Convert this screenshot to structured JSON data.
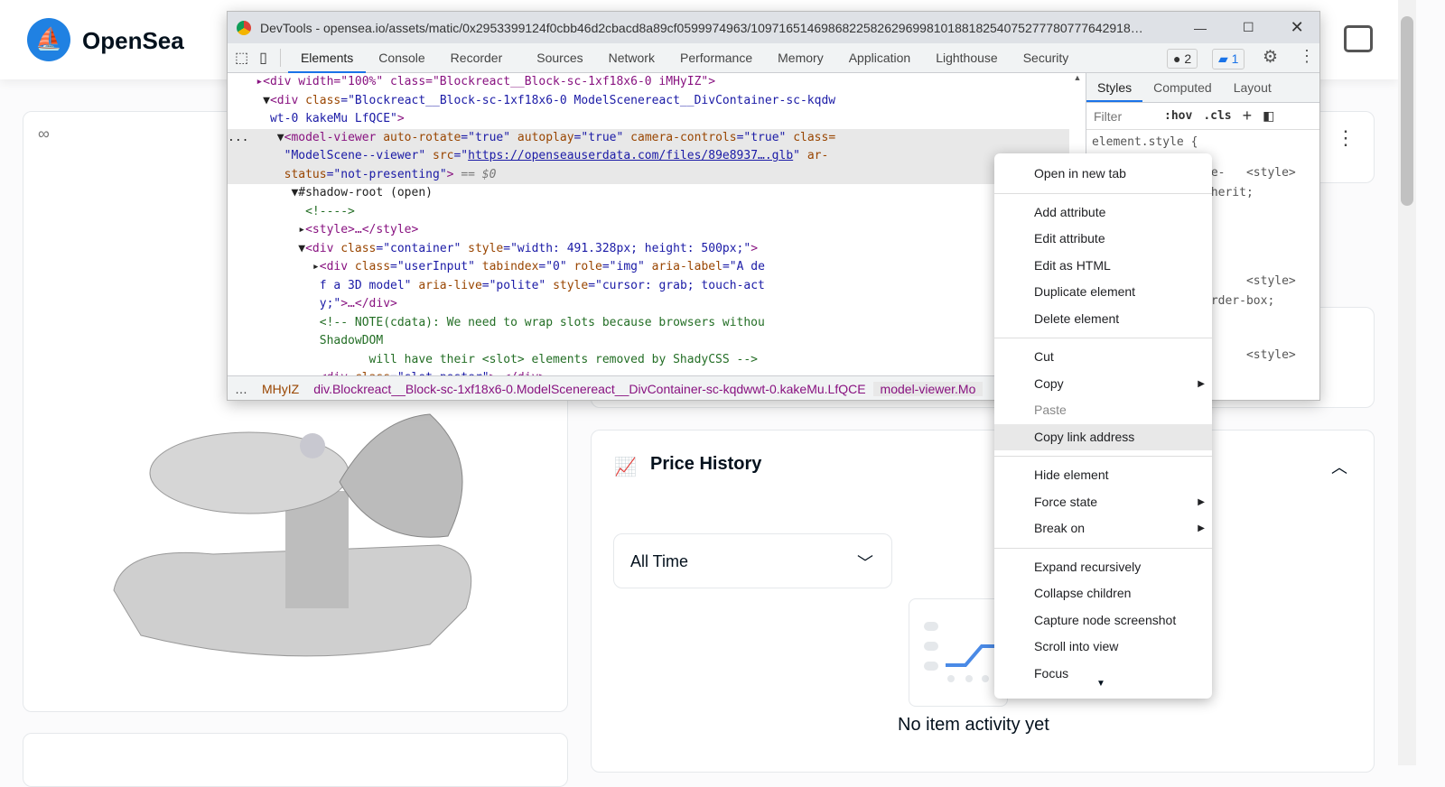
{
  "page": {
    "brand": "OpenSea",
    "price_history": "Price History",
    "filter_value": "All Time",
    "no_activity": "No item activity yet"
  },
  "devtools": {
    "title": "DevTools - opensea.io/assets/matic/0x2953399124f0cbb46d2cbacd8a89cf0599974963/109716514698682258262969981018818254075277780777642918…",
    "tabs": [
      "Elements",
      "Console",
      "Recorder",
      "Sources",
      "Network",
      "Performance",
      "Memory",
      "Application",
      "Lighthouse",
      "Security"
    ],
    "errors": "2",
    "messages": "1",
    "code": [
      [
        [
          "    ",
          "tx"
        ],
        [
          "▸<div width=\"100%\" class=\"Blockreact__Block-sc-1xf18x6-0 iMHyIZ\">",
          "tg"
        ]
      ],
      [
        [
          "     ▼",
          "tx"
        ],
        [
          "<div ",
          "tg"
        ],
        [
          "class",
          "at"
        ],
        [
          "=\"Blockreact__Block-sc-1xf18x6-0 ModelScenereact__DivContainer-sc-kqdw",
          "av"
        ]
      ],
      [
        [
          "      ",
          "tx"
        ],
        [
          "wt-0 kakeMu LfQCE\"",
          "av"
        ],
        [
          ">",
          "tg"
        ]
      ],
      [
        [
          "...    ▼",
          "tx"
        ],
        [
          "<model-viewer ",
          "tg"
        ],
        [
          "auto-rotate",
          "at"
        ],
        [
          "=\"true\" ",
          "av"
        ],
        [
          "autoplay",
          "at"
        ],
        [
          "=\"true\" ",
          "av"
        ],
        [
          "camera-controls",
          "at"
        ],
        [
          "=\"true\" ",
          "av"
        ],
        [
          "class=",
          "at"
        ]
      ],
      [
        [
          "        ",
          "tx"
        ],
        [
          "\"ModelScene--viewer\" ",
          "av"
        ],
        [
          "src",
          "at"
        ],
        [
          "=\"",
          "av"
        ],
        [
          "https://openseauserdata.com/files/89e8937….glb",
          "lk"
        ],
        [
          "\" ",
          "av"
        ],
        [
          "ar-",
          "at"
        ]
      ],
      [
        [
          "        ",
          "tx"
        ],
        [
          "status",
          "at"
        ],
        [
          "=\"not-presenting\"",
          "av"
        ],
        [
          "> ",
          "tg"
        ],
        [
          "== $0",
          "gr"
        ]
      ],
      [
        [
          "         ▼",
          "tx"
        ],
        [
          "#shadow-root (open)",
          "tx"
        ]
      ],
      [
        [
          "           ",
          "tx"
        ],
        [
          "<!---->",
          "cm"
        ]
      ],
      [
        [
          "          ▸",
          "tx"
        ],
        [
          "<style>…</style>",
          "tg"
        ]
      ],
      [
        [
          "          ▼",
          "tx"
        ],
        [
          "<div ",
          "tg"
        ],
        [
          "class",
          "at"
        ],
        [
          "=\"container\" ",
          "av"
        ],
        [
          "style",
          "at"
        ],
        [
          "=\"width: 491.328px; height: 500px;\"",
          "av"
        ],
        [
          ">",
          "tg"
        ]
      ],
      [
        [
          "            ▸",
          "tx"
        ],
        [
          "<div ",
          "tg"
        ],
        [
          "class",
          "at"
        ],
        [
          "=\"userInput\" ",
          "av"
        ],
        [
          "tabindex",
          "at"
        ],
        [
          "=\"0\" ",
          "av"
        ],
        [
          "role",
          "at"
        ],
        [
          "=\"img\" ",
          "av"
        ],
        [
          "aria-label",
          "at"
        ],
        [
          "=\"A de",
          "av"
        ]
      ],
      [
        [
          "             ",
          "tx"
        ],
        [
          "f a 3D model\" ",
          "av"
        ],
        [
          "aria-live",
          "at"
        ],
        [
          "=\"polite\" ",
          "av"
        ],
        [
          "style",
          "at"
        ],
        [
          "=\"cursor: grab; touch-act",
          "av"
        ]
      ],
      [
        [
          "             ",
          "tx"
        ],
        [
          "y;\"",
          "av"
        ],
        [
          ">…</div>",
          "tg"
        ]
      ],
      [
        [
          "             ",
          "tx"
        ],
        [
          "<!-- NOTE(cdata): We need to wrap slots because browsers withou",
          "cm"
        ]
      ],
      [
        [
          "             ",
          "tx"
        ],
        [
          "ShadowDOM",
          "cm"
        ]
      ],
      [
        [
          "                    ",
          "tx"
        ],
        [
          "will have their <slot> elements removed by ShadyCSS -->",
          "cm"
        ]
      ],
      [
        [
          "            ▸",
          "tx"
        ],
        [
          "<div ",
          "tg"
        ],
        [
          "class",
          "at"
        ],
        [
          "=\"slot poster\"",
          "av"
        ],
        [
          ">…</div>",
          "tg"
        ]
      ]
    ],
    "breadcrumb": [
      "…",
      "MHyIZ",
      "div.Blockreact__Block-sc-1xf18x6-0.ModelScenereact__DivContainer-sc-kqdwwt-0.kakeMu.LfQCE",
      "model-viewer.Mo"
    ],
    "styles": {
      "tabs": [
        "Styles",
        "Computed",
        "Layout"
      ],
      "filter_placeholder": "Filter",
      "hov": ":hov",
      "cls": ".cls",
      "lines": [
        "element.style {",
        "ne-   <style>",
        "nherit;",
        "      <style>",
        "order-box;",
        "      <style>"
      ]
    }
  },
  "context_menu": {
    "groups": [
      [
        "Open in new tab"
      ],
      [
        "Add attribute",
        "Edit attribute",
        "Edit as HTML",
        "Duplicate element",
        "Delete element"
      ],
      [
        "Cut",
        "Copy",
        "Paste",
        "Copy link address"
      ],
      [
        "Hide element",
        "Force state",
        "Break on"
      ],
      [
        "Expand recursively",
        "Collapse children",
        "Capture node screenshot",
        "Scroll into view",
        "Focus"
      ]
    ],
    "submenu": [
      "Copy",
      "Force state",
      "Break on"
    ],
    "disabled": [
      "Paste"
    ],
    "hovered": "Copy link address"
  },
  "colors": {
    "accent": "#2081e2",
    "devtools_tab": "#1a73e8"
  }
}
